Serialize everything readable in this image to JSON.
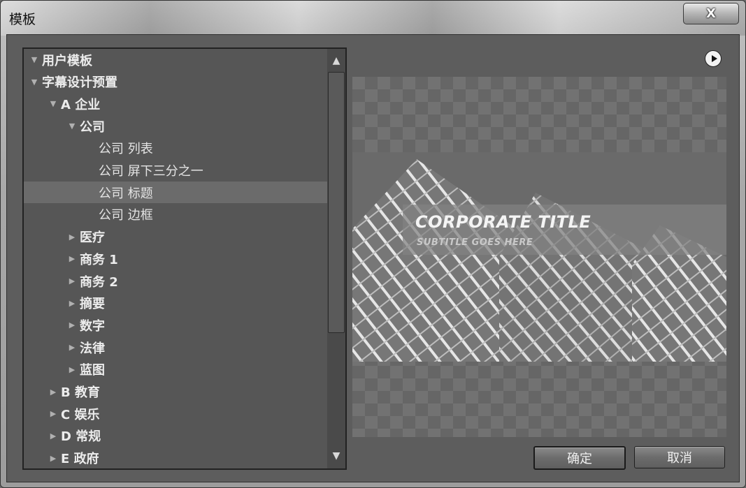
{
  "window": {
    "title": "模板",
    "close_label": "X"
  },
  "tree": {
    "items": [
      {
        "label": "用户模板",
        "level": 0,
        "expanded": true,
        "has_children": true,
        "bold": true
      },
      {
        "label": "字幕设计预置",
        "level": 0,
        "expanded": true,
        "has_children": true,
        "bold": true
      },
      {
        "label": "A 企业",
        "level": 1,
        "expanded": true,
        "has_children": true,
        "bold": true
      },
      {
        "label": "公司",
        "level": 2,
        "expanded": true,
        "has_children": true,
        "bold": true
      },
      {
        "label": "公司 列表",
        "level": 3,
        "has_children": false,
        "bold": false
      },
      {
        "label": "公司 屏下三分之一",
        "level": 3,
        "has_children": false,
        "bold": false
      },
      {
        "label": "公司 标题",
        "level": 3,
        "has_children": false,
        "bold": false,
        "selected": true
      },
      {
        "label": "公司 边框",
        "level": 3,
        "has_children": false,
        "bold": false
      },
      {
        "label": "医疗",
        "level": 2,
        "expanded": false,
        "has_children": true,
        "bold": true
      },
      {
        "label": "商务 1",
        "level": 2,
        "expanded": false,
        "has_children": true,
        "bold": true
      },
      {
        "label": "商务 2",
        "level": 2,
        "expanded": false,
        "has_children": true,
        "bold": true
      },
      {
        "label": "摘要",
        "level": 2,
        "expanded": false,
        "has_children": true,
        "bold": true
      },
      {
        "label": "数字",
        "level": 2,
        "expanded": false,
        "has_children": true,
        "bold": true
      },
      {
        "label": "法律",
        "level": 2,
        "expanded": false,
        "has_children": true,
        "bold": true
      },
      {
        "label": "蓝图",
        "level": 2,
        "expanded": false,
        "has_children": true,
        "bold": true
      },
      {
        "label": "B 教育",
        "level": 1,
        "expanded": false,
        "has_children": true,
        "bold": true
      },
      {
        "label": "C 娱乐",
        "level": 1,
        "expanded": false,
        "has_children": true,
        "bold": true
      },
      {
        "label": "D 常规",
        "level": 1,
        "expanded": false,
        "has_children": true,
        "bold": true
      },
      {
        "label": "E 政府",
        "level": 1,
        "expanded": false,
        "has_children": true,
        "bold": true
      }
    ]
  },
  "preview": {
    "title": "CORPORATE TITLE",
    "subtitle": "SUBTITLE GOES HERE"
  },
  "buttons": {
    "ok": "确定",
    "cancel": "取消"
  },
  "icons": {
    "expanded": "triangle-down-icon",
    "collapsed": "triangle-right-icon",
    "menu": "play-circle-icon",
    "scroll_up": "chevron-up-icon",
    "scroll_down": "chevron-down-icon"
  }
}
